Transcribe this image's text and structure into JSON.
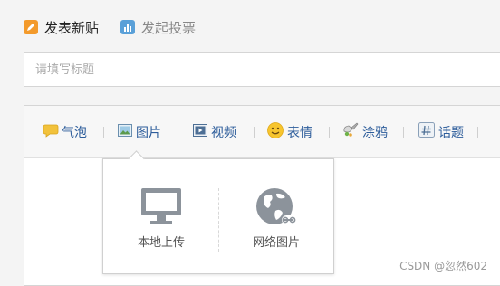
{
  "tabs": {
    "post_label": "发表新贴",
    "vote_label": "发起投票"
  },
  "title_input": {
    "placeholder": "请填写标题",
    "value": ""
  },
  "toolbar": {
    "bubble": "气泡",
    "image": "图片",
    "video": "视频",
    "emoji": "表情",
    "doodle": "涂鸦",
    "topic": "话题"
  },
  "image_popup": {
    "local_upload": "本地上传",
    "web_image": "网络图片"
  },
  "watermark": "CSDN @忽然602",
  "colors": {
    "link_blue": "#2d5d9b",
    "post_icon": "#f39a2b",
    "vote_icon": "#5aa0d8",
    "popup_icon": "#8c939b"
  }
}
